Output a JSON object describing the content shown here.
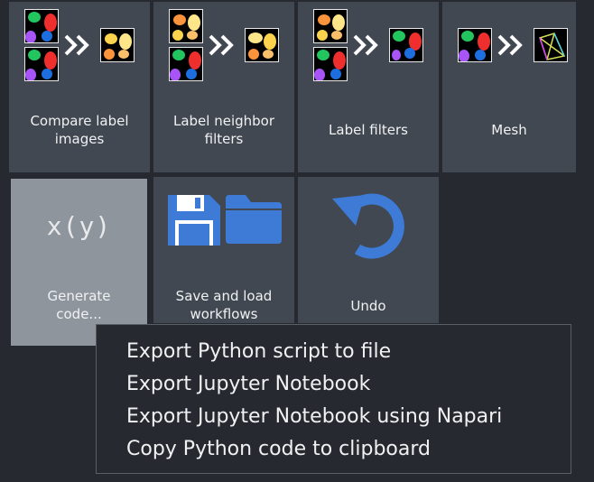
{
  "tiles": [
    {
      "label_line1": "Compare label",
      "label_line2": "images"
    },
    {
      "label_line1": "Label neighbor",
      "label_line2": "filters"
    },
    {
      "label": "Label filters"
    },
    {
      "label": "Mesh"
    },
    {
      "label_line1": "Generate",
      "label_line2": "code...",
      "icon_text": "x(y)"
    },
    {
      "label_line1": "Save and load",
      "label_line2": "workflows"
    },
    {
      "label": "Undo"
    }
  ],
  "context_menu": {
    "items": [
      "Export Python script to file",
      "Export Jupyter Notebook",
      "Export Jupyter Notebook using Napari",
      "Copy Python code to clipboard"
    ]
  },
  "colors": {
    "background": "#262930",
    "tile": "#414851",
    "tile_active": "#8f959d",
    "icon_blue": "#3d7bd6",
    "text": "#f0f1f2"
  },
  "icons": [
    "label-image-icon",
    "double-chevron-right-icon",
    "floppy-disk-icon",
    "folder-icon",
    "undo-arrow-icon",
    "mesh-icon"
  ]
}
